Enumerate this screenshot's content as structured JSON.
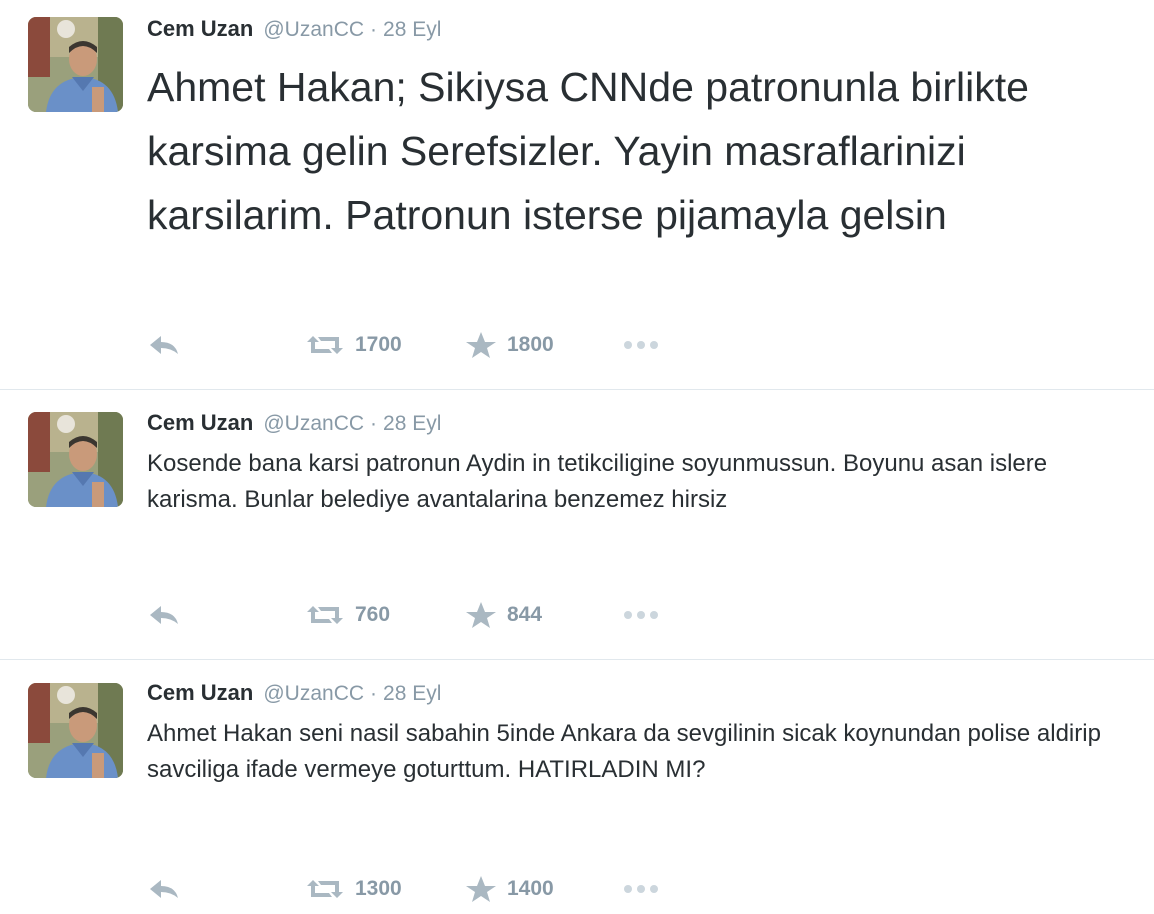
{
  "colors": {
    "text": "#292f33",
    "meta": "#8899a6",
    "action_icon": "#aab8c2",
    "divider": "#e1e8ed"
  },
  "tweets": [
    {
      "fullname": "Cem Uzan",
      "username": "@UzanCC",
      "separator": "·",
      "time": "28 Eyl",
      "text": "Ahmet Hakan; Sikiysa CNNde patronunla birlikte karsima gelin Serefsizler. Yayin masraflarinizi karsilarim. Patronun isterse pijamayla gelsin",
      "retweets": "1700",
      "favorites": "1800"
    },
    {
      "fullname": "Cem Uzan",
      "username": "@UzanCC",
      "separator": "·",
      "time": "28 Eyl",
      "text": "Kosende bana karsi patronun Aydin in tetikciligine soyunmussun. Boyunu asan islere karisma.  Bunlar belediye avantalarina benzemez hirsiz",
      "retweets": "760",
      "favorites": "844"
    },
    {
      "fullname": "Cem Uzan",
      "username": "@UzanCC",
      "separator": "·",
      "time": "28 Eyl",
      "text": "Ahmet Hakan seni nasil sabahin 5inde Ankara da sevgilinin sicak koynundan polise aldirip savciliga ifade vermeye goturttum. HATIRLADIN MI?",
      "retweets": "1300",
      "favorites": "1400"
    }
  ],
  "icons": {
    "avatar": "avatar-photo",
    "reply": "reply-icon",
    "retweet": "retweet-icon",
    "favorite": "star-icon",
    "more": "more-icon"
  }
}
